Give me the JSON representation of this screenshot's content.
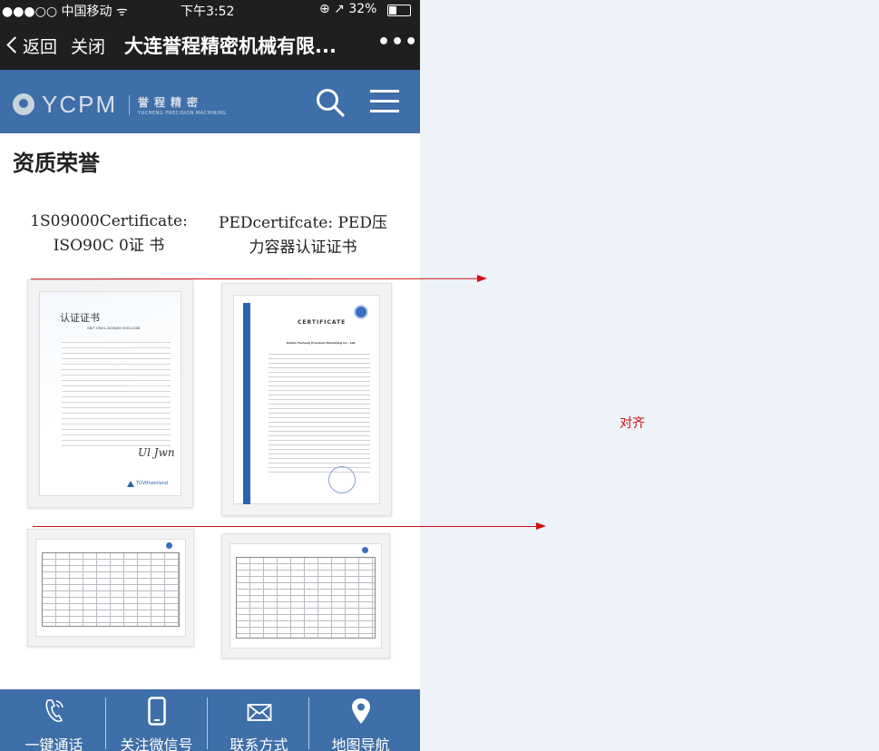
{
  "status_bar": {
    "carrier": "●●●○○ 中国移动 ᯤ",
    "time": "下午3:52",
    "battery": "⊕ ↗ 32%"
  },
  "nav": {
    "back_label": "返回",
    "close_label": "关闭",
    "title": "大连誉程精密机械有限...",
    "more_label": "•••"
  },
  "header": {
    "logo_text": "YCPM",
    "logo_cn": "誉程精密",
    "logo_en": "YUCHENG PRECISION MACHINING"
  },
  "page_title": "资质荣誉",
  "certificates": [
    {
      "caption": "1S09000Certificate: ISO90C 0证 书"
    },
    {
      "caption": "PEDcertifcate: PED压力容器认证证书"
    }
  ],
  "cert_docs": {
    "cn_title": "认证证书",
    "cn_subtitle": "GB/T 19001-2008/ISO 9001:2008",
    "tuv": "TÜVRheinland",
    "ped_title": "CERTIFICATE",
    "ped_company": "Dalian Yucheng Precision Machining Co., Ltd."
  },
  "tabbar": [
    {
      "label": "一键通话",
      "icon": "phone-icon"
    },
    {
      "label": "关注微信号",
      "icon": "mobile-icon"
    },
    {
      "label": "联系方式",
      "icon": "mail-icon"
    },
    {
      "label": "地图导航",
      "icon": "map-pin-icon"
    }
  ],
  "annotation": {
    "text": "对齐",
    "color": "#d01010"
  }
}
